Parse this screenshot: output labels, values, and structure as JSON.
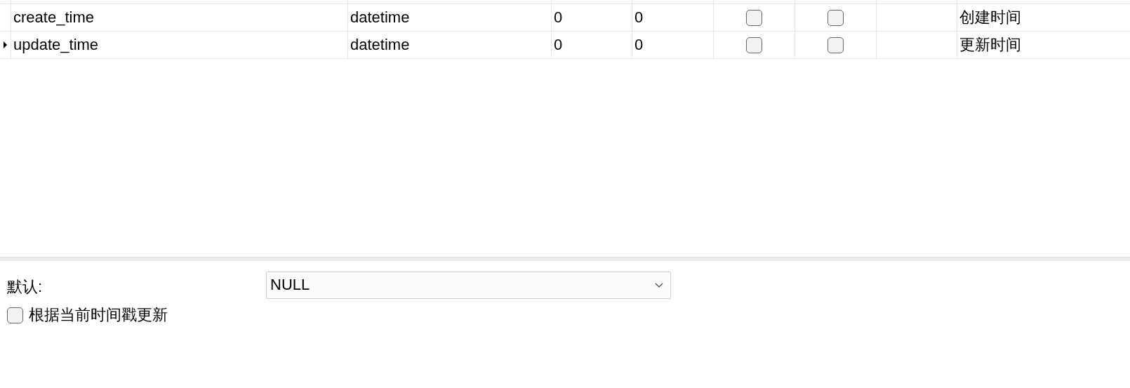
{
  "fields_table": {
    "rows": [
      {
        "current": false,
        "name": "create_time",
        "type": "datetime",
        "length": "0",
        "decimals": "0",
        "not_null": false,
        "key": false,
        "comment": "创建时间"
      },
      {
        "current": true,
        "name": "update_time",
        "type": "datetime",
        "length": "0",
        "decimals": "0",
        "not_null": false,
        "key": false,
        "comment": "更新时间"
      }
    ]
  },
  "field_properties": {
    "default_label": "默认:",
    "default_value": "NULL",
    "on_update": {
      "label": "根据当前时间戳更新",
      "checked": false
    }
  }
}
